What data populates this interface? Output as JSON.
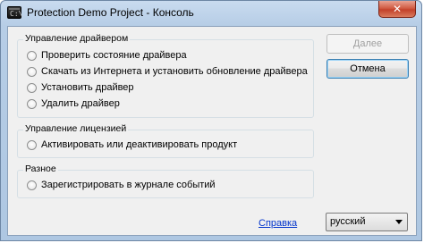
{
  "window": {
    "title": "Protection Demo Project - Консоль",
    "icon_text": "C:\\",
    "close_symbol": "✕"
  },
  "driver_group": {
    "label": "Управление драйвером",
    "options": [
      "Проверить состояние драйвера",
      "Скачать из Интернета и установить обновление драйвера",
      "Установить драйвер",
      "Удалить драйвер"
    ]
  },
  "license_group": {
    "label": "Управление лицензией",
    "options": [
      "Активировать или деактивировать продукт"
    ]
  },
  "misc_group": {
    "label": "Разное",
    "options": [
      "Зарегистрировать в журнале событий"
    ]
  },
  "buttons": {
    "next": "Далее",
    "cancel": "Отмена"
  },
  "help_link": "Справка",
  "language_select": {
    "value": "русский"
  }
}
